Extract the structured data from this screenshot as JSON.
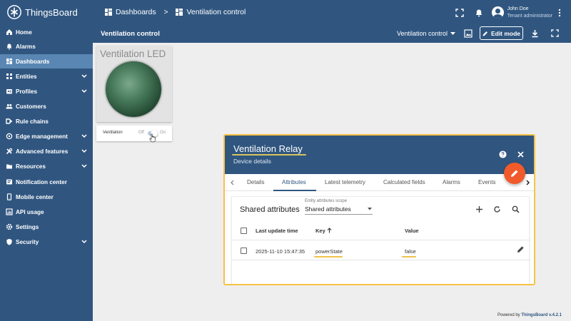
{
  "app": {
    "name": "ThingsBoard"
  },
  "breadcrumb": {
    "root": "Dashboards",
    "separator": ">",
    "current": "Ventilation control"
  },
  "user": {
    "name": "John Doe",
    "role": "Tenant administrator"
  },
  "sidebar": {
    "items": [
      {
        "label": "Home",
        "icon": "home-icon"
      },
      {
        "label": "Alarms",
        "icon": "alarm-icon"
      },
      {
        "label": "Dashboards",
        "icon": "dashboards-icon",
        "active": true
      },
      {
        "label": "Entities",
        "icon": "entities-icon",
        "expandable": true
      },
      {
        "label": "Profiles",
        "icon": "profiles-icon",
        "expandable": true
      },
      {
        "label": "Customers",
        "icon": "customers-icon"
      },
      {
        "label": "Rule chains",
        "icon": "rule-chains-icon"
      },
      {
        "label": "Edge management",
        "icon": "edge-icon",
        "expandable": true
      },
      {
        "label": "Advanced features",
        "icon": "tools-icon",
        "expandable": true
      },
      {
        "label": "Resources",
        "icon": "folder-icon",
        "expandable": true
      },
      {
        "label": "Notification center",
        "icon": "notification-icon"
      },
      {
        "label": "Mobile center",
        "icon": "mobile-icon"
      },
      {
        "label": "API usage",
        "icon": "api-usage-icon"
      },
      {
        "label": "Settings",
        "icon": "settings-icon"
      },
      {
        "label": "Security",
        "icon": "security-icon",
        "expandable": true
      }
    ]
  },
  "dashboard": {
    "title": "Ventilation control",
    "state": "Ventilation control",
    "edit_label": "Edit mode"
  },
  "widgets": {
    "led": {
      "title": "Ventilation LED",
      "color": "#4a7c5c"
    },
    "switch": {
      "label": "Ventilation",
      "off": "Off",
      "on": "On",
      "value": false
    }
  },
  "dialog": {
    "title": "Ventilation Relay",
    "subtitle": "Device details",
    "tabs": [
      "Details",
      "Attributes",
      "Latest telemetry",
      "Calculated fields",
      "Alarms",
      "Events"
    ],
    "active_tab": "Attributes",
    "attributes": {
      "title": "Shared attributes",
      "scope_label": "Entity attributes scope",
      "scope_value": "Shared attributes",
      "columns": {
        "time": "Last update time",
        "key": "Key",
        "value": "Value"
      },
      "rows": [
        {
          "time": "2025-11-10 15:47:35",
          "key": "powerState",
          "value": "false"
        }
      ]
    }
  },
  "footer": {
    "prefix": "Powered by",
    "brand": "ThingsBoard v.4.2.1"
  },
  "colors": {
    "primary": "#305680",
    "accent": "#f15a2b",
    "highlight": "#f6c343",
    "active_nav": "#5986b3"
  }
}
